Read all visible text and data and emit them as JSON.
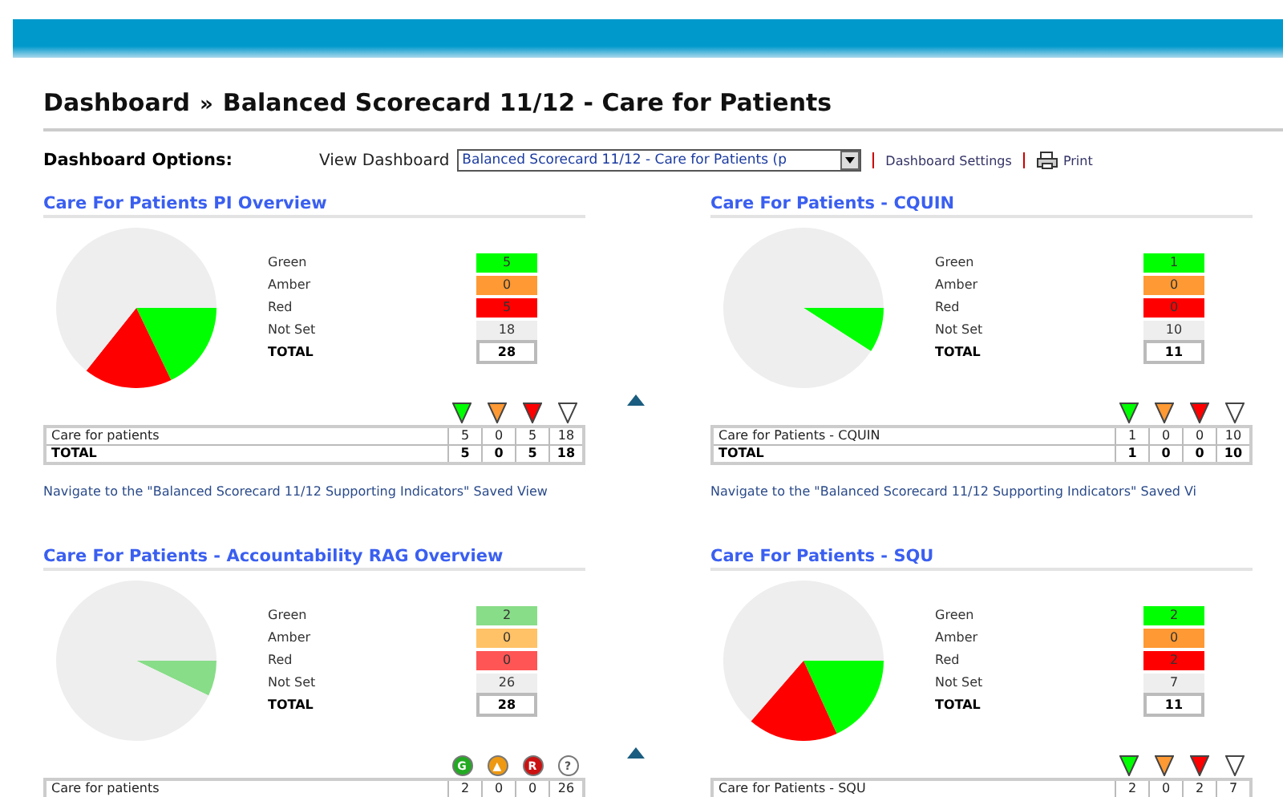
{
  "breadcrumb": {
    "root": "Dashboard",
    "separator": "»",
    "current": "Balanced Scorecard 11/12 - Care for Patients"
  },
  "options": {
    "label": "Dashboard Options:",
    "view_label": "View Dashboard",
    "view_value": "Balanced Scorecard 11/12 - Care for Patients (p",
    "settings_link": "Dashboard Settings",
    "print_link": "Print"
  },
  "panels": [
    {
      "title": "Care For Patients PI Overview",
      "summary": [
        {
          "label": "Green",
          "value": "5",
          "color": "#00ff00"
        },
        {
          "label": "Amber",
          "value": "0",
          "color": "#ff9933"
        },
        {
          "label": "Red",
          "value": "5",
          "color": "#ff0000"
        },
        {
          "label": "Not Set",
          "value": "18",
          "color": "#eeeeee"
        }
      ],
      "total_label": "TOTAL",
      "total": "28",
      "indicators": [
        {
          "kind": "triangle",
          "color": "#00ff00"
        },
        {
          "kind": "triangle",
          "color": "#ff9933"
        },
        {
          "kind": "triangle",
          "color": "#ff0000"
        },
        {
          "kind": "triangle",
          "color": "#ffffff"
        }
      ],
      "rows": [
        {
          "kind": "item",
          "name": "Care for patients",
          "values": [
            "5",
            "0",
            "5",
            "18"
          ]
        },
        {
          "kind": "total",
          "name": "TOTAL",
          "values": [
            "5",
            "0",
            "5",
            "18"
          ]
        }
      ],
      "link": "Navigate to the \"Balanced Scorecard 11/12 Supporting Indicators\" Saved View",
      "top_arrow": true
    },
    {
      "title": "Care For Patients - CQUIN",
      "summary": [
        {
          "label": "Green",
          "value": "1",
          "color": "#00ff00"
        },
        {
          "label": "Amber",
          "value": "0",
          "color": "#ff9933"
        },
        {
          "label": "Red",
          "value": "0",
          "color": "#ff0000"
        },
        {
          "label": "Not Set",
          "value": "10",
          "color": "#eeeeee"
        }
      ],
      "total_label": "TOTAL",
      "total": "11",
      "indicators": [
        {
          "kind": "triangle",
          "color": "#00ff00"
        },
        {
          "kind": "triangle",
          "color": "#ff9933"
        },
        {
          "kind": "triangle",
          "color": "#ff0000"
        },
        {
          "kind": "triangle",
          "color": "#ffffff"
        }
      ],
      "rows": [
        {
          "kind": "item",
          "name": "Care for Patients - CQUIN",
          "values": [
            "1",
            "0",
            "0",
            "10"
          ]
        },
        {
          "kind": "total",
          "name": "TOTAL",
          "values": [
            "1",
            "0",
            "0",
            "10"
          ]
        }
      ],
      "link": "Navigate to the \"Balanced Scorecard 11/12 Supporting Indicators\" Saved Vi",
      "top_arrow": false
    },
    {
      "title": "Care For Patients - Accountability RAG Overview",
      "summary": [
        {
          "label": "Green",
          "value": "2",
          "color": "#88dd88"
        },
        {
          "label": "Amber",
          "value": "0",
          "color": "#ffc266"
        },
        {
          "label": "Red",
          "value": "0",
          "color": "#ff5555"
        },
        {
          "label": "Not Set",
          "value": "26",
          "color": "#eeeeee"
        }
      ],
      "total_label": "TOTAL",
      "total": "28",
      "indicators": [
        {
          "kind": "circle",
          "color": "#22aa22",
          "glyph": "G"
        },
        {
          "kind": "circle",
          "color": "#ee9911",
          "glyph": "▲"
        },
        {
          "kind": "circle",
          "color": "#cc1111",
          "glyph": "R"
        },
        {
          "kind": "circle",
          "color": "#ffffff",
          "glyph": "?"
        }
      ],
      "rows": [
        {
          "kind": "item",
          "name": "Care for patients",
          "values": [
            "2",
            "0",
            "0",
            "26"
          ]
        }
      ],
      "top_arrow": true
    },
    {
      "title": "Care For Patients - SQU",
      "summary": [
        {
          "label": "Green",
          "value": "2",
          "color": "#00ff00"
        },
        {
          "label": "Amber",
          "value": "0",
          "color": "#ff9933"
        },
        {
          "label": "Red",
          "value": "2",
          "color": "#ff0000"
        },
        {
          "label": "Not Set",
          "value": "7",
          "color": "#eeeeee"
        }
      ],
      "total_label": "TOTAL",
      "total": "11",
      "indicators": [
        {
          "kind": "triangle",
          "color": "#00ff00"
        },
        {
          "kind": "triangle",
          "color": "#ff9933"
        },
        {
          "kind": "triangle",
          "color": "#ff0000"
        },
        {
          "kind": "triangle",
          "color": "#ffffff"
        }
      ],
      "rows": [
        {
          "kind": "item",
          "name": "Care for Patients - SQU",
          "values": [
            "2",
            "0",
            "2",
            "7"
          ]
        }
      ],
      "top_arrow": false
    }
  ]
}
